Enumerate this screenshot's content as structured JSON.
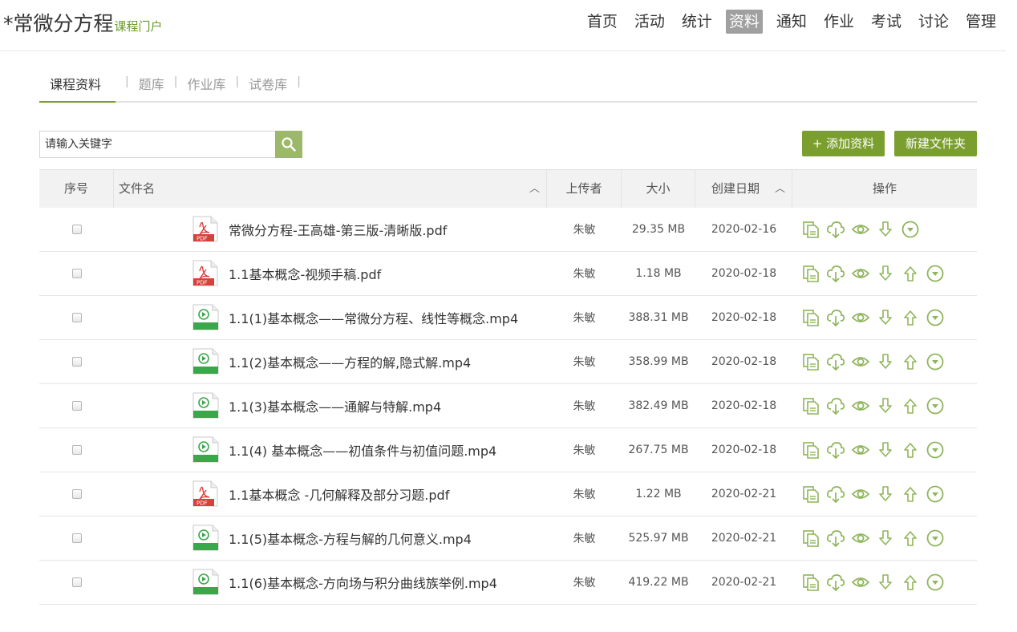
{
  "header": {
    "title": "*常微分方程",
    "subtitle": "课程门户",
    "nav": [
      "首页",
      "活动",
      "统计",
      "资料",
      "通知",
      "作业",
      "考试",
      "讨论",
      "管理"
    ],
    "active_nav": "资料"
  },
  "subtabs": [
    "课程资料",
    "题库",
    "作业库",
    "试卷库"
  ],
  "search": {
    "placeholder": "请输入关键字"
  },
  "buttons": {
    "add": "+ 添加资料",
    "new_folder": "新建文件夹"
  },
  "table": {
    "headers": {
      "index": "序号",
      "name": "文件名",
      "uploader": "上传者",
      "size": "大小",
      "date": "创建日期",
      "ops": "操作"
    },
    "rows": [
      {
        "type": "pdf",
        "name": "常微分方程-王高雄-第三版-清晰版.pdf",
        "uploader": "朱敏",
        "size": "29.35 MB",
        "date": "2020-02-16",
        "has_up": false
      },
      {
        "type": "pdf",
        "name": "1.1基本概念-视频手稿.pdf",
        "uploader": "朱敏",
        "size": "1.18 MB",
        "date": "2020-02-18",
        "has_up": true
      },
      {
        "type": "mp4",
        "name": "1.1(1)基本概念——常微分方程、线性等概念.mp4",
        "uploader": "朱敏",
        "size": "388.31 MB",
        "date": "2020-02-18",
        "has_up": true
      },
      {
        "type": "mp4",
        "name": "1.1(2)基本概念——方程的解,隐式解.mp4",
        "uploader": "朱敏",
        "size": "358.99 MB",
        "date": "2020-02-18",
        "has_up": true
      },
      {
        "type": "mp4",
        "name": "1.1(3)基本概念——通解与特解.mp4",
        "uploader": "朱敏",
        "size": "382.49 MB",
        "date": "2020-02-18",
        "has_up": true
      },
      {
        "type": "mp4",
        "name": "1.1(4) 基本概念——初值条件与初值问题.mp4",
        "uploader": "朱敏",
        "size": "267.75 MB",
        "date": "2020-02-18",
        "has_up": true
      },
      {
        "type": "pdf",
        "name": "1.1基本概念 -几何解释及部分习题.pdf",
        "uploader": "朱敏",
        "size": "1.22 MB",
        "date": "2020-02-21",
        "has_up": true
      },
      {
        "type": "mp4",
        "name": "1.1(5)基本概念-方程与解的几何意义.mp4",
        "uploader": "朱敏",
        "size": "525.97 MB",
        "date": "2020-02-21",
        "has_up": true
      },
      {
        "type": "mp4",
        "name": "1.1(6)基本概念-方向场与积分曲线族举例.mp4",
        "uploader": "朱敏",
        "size": "419.22 MB",
        "date": "2020-02-21",
        "has_up": true
      }
    ]
  },
  "icons": {
    "pdf_file": "pdf-file-icon",
    "video_file": "video-file-icon",
    "copy": "copy-icon",
    "upload_cloud": "cloud-upload-icon",
    "preview": "eye-icon",
    "move_down": "arrow-down-icon",
    "move_up": "arrow-up-icon",
    "more": "circle-chevron-down-icon",
    "search": "search-icon"
  },
  "colors": {
    "accent": "#7a9f2e",
    "icon_green": "#8fb55a",
    "pdf_red": "#d9403a",
    "video_green": "#3aa74a"
  }
}
